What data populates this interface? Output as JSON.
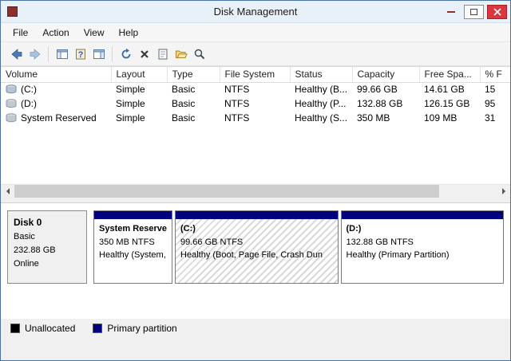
{
  "window": {
    "title": "Disk Management"
  },
  "menu": {
    "items": [
      {
        "label": "File"
      },
      {
        "label": "Action"
      },
      {
        "label": "View"
      },
      {
        "label": "Help"
      }
    ]
  },
  "toolbar": {
    "icons": [
      "back-icon",
      "forward-icon",
      "console-tree-icon",
      "help-icon",
      "action-pane-icon",
      "refresh-icon",
      "delete-volume-icon",
      "properties-icon",
      "open-folder-icon",
      "find-icon"
    ]
  },
  "volume_table": {
    "columns": [
      {
        "label": "Volume"
      },
      {
        "label": "Layout"
      },
      {
        "label": "Type"
      },
      {
        "label": "File System"
      },
      {
        "label": "Status"
      },
      {
        "label": "Capacity"
      },
      {
        "label": "Free Spa..."
      },
      {
        "label": "% F"
      }
    ],
    "rows": [
      {
        "volume": "(C:)",
        "layout": "Simple",
        "type": "Basic",
        "file_system": "NTFS",
        "status": "Healthy (B...",
        "capacity": "99.66 GB",
        "free_space": "14.61 GB",
        "pct_free": "15"
      },
      {
        "volume": "(D:)",
        "layout": "Simple",
        "type": "Basic",
        "file_system": "NTFS",
        "status": "Healthy (P...",
        "capacity": "132.88 GB",
        "free_space": "126.15 GB",
        "pct_free": "95"
      },
      {
        "volume": "System Reserved",
        "layout": "Simple",
        "type": "Basic",
        "file_system": "NTFS",
        "status": "Healthy (S...",
        "capacity": "350 MB",
        "free_space": "109 MB",
        "pct_free": "31"
      }
    ]
  },
  "disk0": {
    "name": "Disk 0",
    "type": "Basic",
    "capacity": "232.88 GB",
    "status": "Online"
  },
  "partitions": [
    {
      "name": "System Reserve",
      "size": "350 MB NTFS",
      "status": "Healthy (System,",
      "selected": false
    },
    {
      "name": "(C:)",
      "size": "99.66 GB NTFS",
      "status": "Healthy (Boot, Page File, Crash Dun",
      "selected": true
    },
    {
      "name": "(D:)",
      "size": "132.88 GB NTFS",
      "status": "Healthy (Primary Partition)",
      "selected": false
    }
  ],
  "legend": {
    "items": [
      {
        "label": "Unallocated",
        "color": "#000000"
      },
      {
        "label": "Primary partition",
        "color": "#000080"
      }
    ]
  },
  "colors": {
    "partition_bar": "#000080",
    "titlebar_bg": "#e8f0fa",
    "window_border": "#4a72a8",
    "close_button": "#d9363e"
  }
}
